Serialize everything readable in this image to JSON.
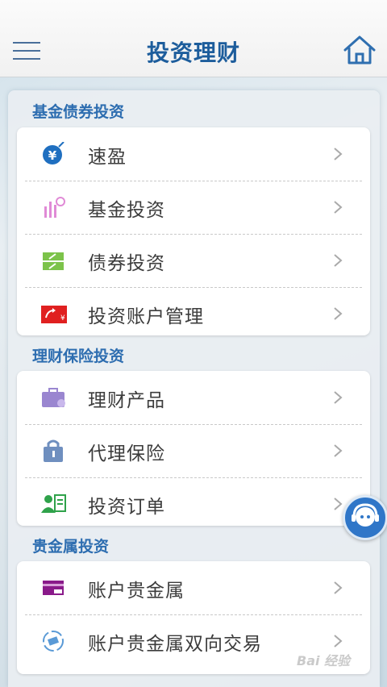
{
  "header": {
    "title": "投资理财"
  },
  "sections": [
    {
      "title": "基金债券投资",
      "items": [
        {
          "label": "速盈",
          "icon": "yen-coin-icon"
        },
        {
          "label": "基金投资",
          "icon": "fund-chart-icon"
        },
        {
          "label": "债券投资",
          "icon": "bond-icon"
        },
        {
          "label": "投资账户管理",
          "icon": "account-transfer-icon"
        }
      ]
    },
    {
      "title": "理财保险投资",
      "items": [
        {
          "label": "理财产品",
          "icon": "briefcase-icon"
        },
        {
          "label": "代理保险",
          "icon": "insurance-lock-icon"
        },
        {
          "label": "投资订单",
          "icon": "order-user-icon"
        }
      ]
    },
    {
      "title": "贵金属投资",
      "items": [
        {
          "label": "账户贵金属",
          "icon": "metal-card-icon"
        },
        {
          "label": "账户贵金属双向交易",
          "icon": "two-way-trade-icon"
        }
      ]
    }
  ],
  "watermark": "Bai 经验",
  "colors": {
    "accent": "#1d5d9c",
    "section": "#2d6db0"
  }
}
